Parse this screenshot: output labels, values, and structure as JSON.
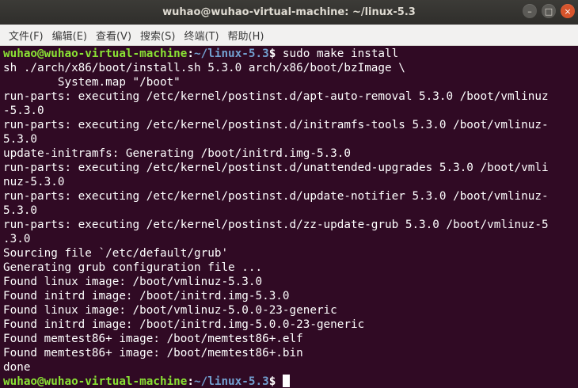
{
  "window": {
    "title": "wuhao@wuhao-virtual-machine: ~/linux-5.3",
    "minimize_glyph": "–",
    "maximize_glyph": "□",
    "close_glyph": "×"
  },
  "menu": {
    "items": [
      {
        "label": "文件(F)"
      },
      {
        "label": "编辑(E)"
      },
      {
        "label": "查看(V)"
      },
      {
        "label": "搜索(S)"
      },
      {
        "label": "终端(T)"
      },
      {
        "label": "帮助(H)"
      }
    ]
  },
  "prompt": {
    "user_host": "wuhao@wuhao-virtual-machine",
    "colon": ":",
    "path": "~/linux-5.3",
    "dollar": "$ "
  },
  "terminal": {
    "command": "sudo make install",
    "output": [
      "sh ./arch/x86/boot/install.sh 5.3.0 arch/x86/boot/bzImage \\",
      "        System.map \"/boot\"",
      "run-parts: executing /etc/kernel/postinst.d/apt-auto-removal 5.3.0 /boot/vmlinuz",
      "-5.3.0",
      "run-parts: executing /etc/kernel/postinst.d/initramfs-tools 5.3.0 /boot/vmlinuz-",
      "5.3.0",
      "update-initramfs: Generating /boot/initrd.img-5.3.0",
      "run-parts: executing /etc/kernel/postinst.d/unattended-upgrades 5.3.0 /boot/vmli",
      "nuz-5.3.0",
      "run-parts: executing /etc/kernel/postinst.d/update-notifier 5.3.0 /boot/vmlinuz-",
      "5.3.0",
      "run-parts: executing /etc/kernel/postinst.d/zz-update-grub 5.3.0 /boot/vmlinuz-5",
      ".3.0",
      "Sourcing file `/etc/default/grub'",
      "Generating grub configuration file ...",
      "Found linux image: /boot/vmlinuz-5.3.0",
      "Found initrd image: /boot/initrd.img-5.3.0",
      "Found linux image: /boot/vmlinuz-5.0.0-23-generic",
      "Found initrd image: /boot/initrd.img-5.0.0-23-generic",
      "Found memtest86+ image: /boot/memtest86+.elf",
      "Found memtest86+ image: /boot/memtest86+.bin",
      "done"
    ]
  },
  "colors": {
    "terminal_bg": "#300a24",
    "prompt_user": "#8ae234",
    "prompt_path": "#729fcf",
    "text": "#ffffff",
    "titlebar": "#3c3b37",
    "menubar": "#f2f1f0",
    "close_button": "#d7542c"
  }
}
